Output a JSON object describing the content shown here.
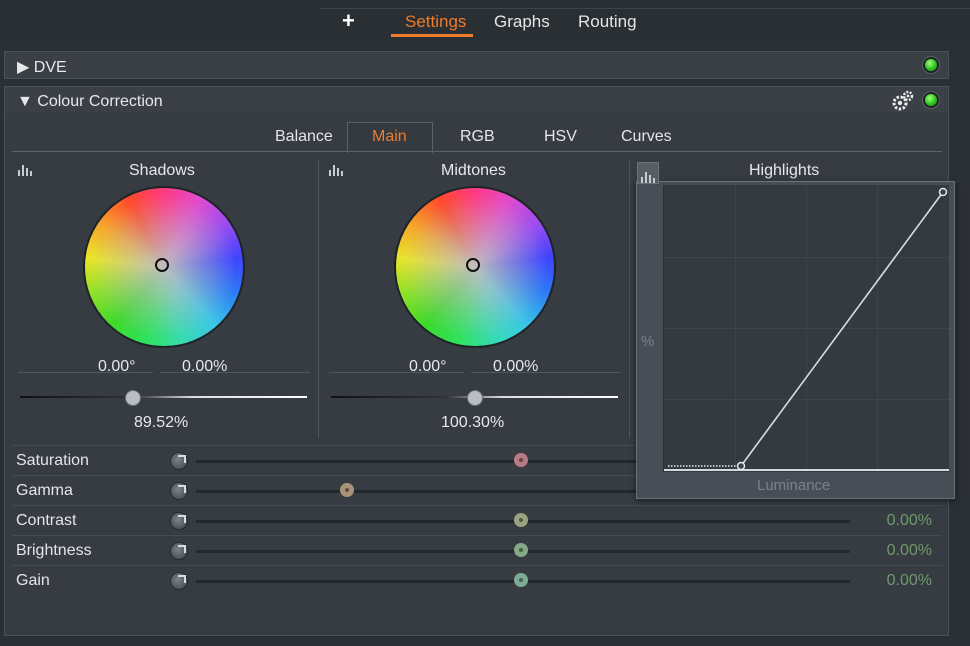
{
  "top_tabs": {
    "add_label": "+",
    "items": [
      {
        "label": "Settings",
        "active": true
      },
      {
        "label": "Graphs",
        "active": false
      },
      {
        "label": "Routing",
        "active": false
      }
    ]
  },
  "sections": {
    "dve": {
      "title": "DVE",
      "expander": "▶",
      "status_color": "#2ec21d"
    },
    "colour_correction": {
      "title": "Colour Correction",
      "expander": "▼",
      "status_color": "#2ec21d",
      "settings_icon": "gears-icon"
    }
  },
  "sub_tabs": [
    {
      "label": "Balance",
      "active": false
    },
    {
      "label": "Main",
      "active": true
    },
    {
      "label": "RGB",
      "active": false
    },
    {
      "label": "HSV",
      "active": false
    },
    {
      "label": "Curves",
      "active": false
    }
  ],
  "wheels": {
    "shadows": {
      "title": "Shadows",
      "angle": "0.00°",
      "magnitude": "0.00%",
      "slider_value": "89.52%",
      "slider_fraction": 0.39
    },
    "midtones": {
      "title": "Midtones",
      "angle": "0.00°",
      "magnitude": "0.00%",
      "slider_value": "100.30%",
      "slider_fraction": 0.5
    },
    "highlights": {
      "title": "Highlights"
    }
  },
  "curve_popup": {
    "y_label": "%",
    "x_label": "Luminance"
  },
  "params": [
    {
      "label": "Saturation",
      "value": "",
      "fraction": 0.5,
      "knob_color": "#b87b82"
    },
    {
      "label": "Gamma",
      "value": "",
      "fraction": 0.23,
      "knob_color": "#a89376"
    },
    {
      "label": "Contrast",
      "value": "0.00%",
      "fraction": 0.5,
      "knob_color": "#9aa57f"
    },
    {
      "label": "Brightness",
      "value": "0.00%",
      "fraction": 0.5,
      "knob_color": "#86a985"
    },
    {
      "label": "Gain",
      "value": "0.00%",
      "fraction": 0.5,
      "knob_color": "#80aa95"
    }
  ],
  "colors": {
    "accent": "#f07b2a",
    "value_text": "#6e9a6b"
  }
}
